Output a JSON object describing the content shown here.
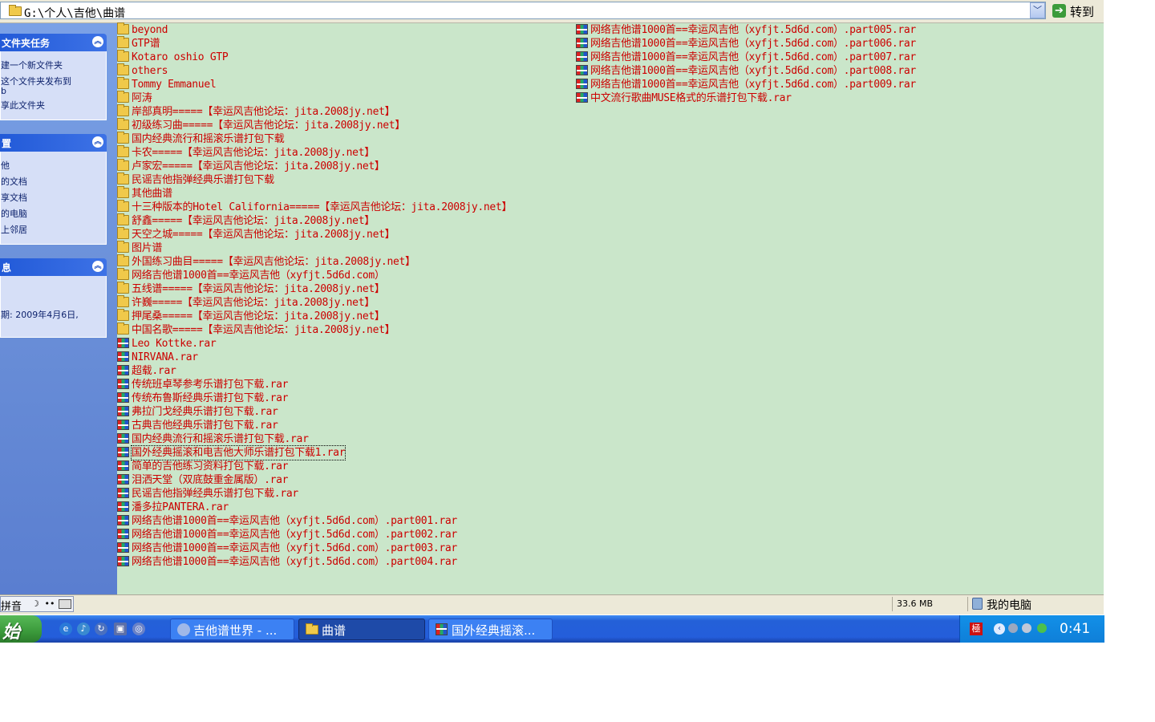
{
  "address": {
    "path": "G:\\个人\\吉他\\曲谱",
    "go_label": "转到",
    "dropdown_glyph": "﹀"
  },
  "tasks_panel": {
    "title": "文件夹任务",
    "items": [
      "建一个新文件夹",
      "这个文件夹发布到",
      "b",
      "享此文件夹"
    ]
  },
  "places_panel": {
    "title": "置",
    "items": [
      "他",
      "的文档",
      "享文档",
      "的电脑",
      "上邻居"
    ]
  },
  "details_panel": {
    "title": "息",
    "items": [
      "期: 2009年4月6日,"
    ]
  },
  "files_col1": [
    {
      "name": "beyond",
      "type": "folder"
    },
    {
      "name": "GTP谱",
      "type": "folder"
    },
    {
      "name": "Kotaro oshio GTP",
      "type": "folder"
    },
    {
      "name": "others",
      "type": "folder"
    },
    {
      "name": "Tommy Emmanuel",
      "type": "folder"
    },
    {
      "name": "阿涛",
      "type": "folder"
    },
    {
      "name": "岸部真明=====【幸运风吉他论坛：jita.2008jy.net】",
      "type": "folder"
    },
    {
      "name": "初级练习曲=====【幸运风吉他论坛：jita.2008jy.net】",
      "type": "folder"
    },
    {
      "name": "国内经典流行和摇滚乐谱打包下载",
      "type": "folder"
    },
    {
      "name": "卡农=====【幸运风吉他论坛：jita.2008jy.net】",
      "type": "folder"
    },
    {
      "name": "卢家宏=====【幸运风吉他论坛：jita.2008jy.net】",
      "type": "folder"
    },
    {
      "name": "民谣吉他指弹经典乐谱打包下载",
      "type": "folder"
    },
    {
      "name": "其他曲谱",
      "type": "folder"
    },
    {
      "name": "十三种版本的Hotel California=====【幸运风吉他论坛：jita.2008jy.net】",
      "type": "folder"
    },
    {
      "name": "舒鑫=====【幸运风吉他论坛：jita.2008jy.net】",
      "type": "folder"
    },
    {
      "name": "天空之城=====【幸运风吉他论坛：jita.2008jy.net】",
      "type": "folder"
    },
    {
      "name": "图片谱",
      "type": "folder"
    },
    {
      "name": "外国练习曲目=====【幸运风吉他论坛：jita.2008jy.net】",
      "type": "folder"
    },
    {
      "name": "网络吉他谱1000首==幸运风吉他（xyfjt.5d6d.com）",
      "type": "folder"
    },
    {
      "name": "五线谱=====【幸运风吉他论坛：jita.2008jy.net】",
      "type": "folder"
    },
    {
      "name": "许巍=====【幸运风吉他论坛：jita.2008jy.net】",
      "type": "folder"
    },
    {
      "name": "押尾桑=====【幸运风吉他论坛：jita.2008jy.net】",
      "type": "folder"
    },
    {
      "name": "中国名歌=====【幸运风吉他论坛：jita.2008jy.net】",
      "type": "folder"
    },
    {
      "name": "Leo Kottke.rar",
      "type": "rar"
    },
    {
      "name": "NIRVANA.rar",
      "type": "rar"
    },
    {
      "name": "超载.rar",
      "type": "rar"
    },
    {
      "name": "传统班卓琴参考乐谱打包下载.rar",
      "type": "rar"
    },
    {
      "name": "传统布鲁斯经典乐谱打包下载.rar",
      "type": "rar"
    },
    {
      "name": "弗拉门戈经典乐谱打包下载.rar",
      "type": "rar"
    },
    {
      "name": "古典吉他经典乐谱打包下载.rar",
      "type": "rar"
    },
    {
      "name": "国内经典流行和摇滚乐谱打包下载.rar",
      "type": "rar"
    },
    {
      "name": "国外经典摇滚和电吉他大师乐谱打包下载1.rar",
      "type": "rar",
      "selected": true
    },
    {
      "name": "简单的吉他练习资料打包下载.rar",
      "type": "rar"
    },
    {
      "name": "泪洒天堂（双底鼓重金属版）.rar",
      "type": "rar"
    },
    {
      "name": "民谣吉他指弹经典乐谱打包下载.rar",
      "type": "rar"
    },
    {
      "name": "潘多拉PANTERA.rar",
      "type": "rar"
    },
    {
      "name": "网络吉他谱1000首==幸运风吉他（xyfjt.5d6d.com）.part001.rar",
      "type": "rar"
    },
    {
      "name": "网络吉他谱1000首==幸运风吉他（xyfjt.5d6d.com）.part002.rar",
      "type": "rar"
    },
    {
      "name": "网络吉他谱1000首==幸运风吉他（xyfjt.5d6d.com）.part003.rar",
      "type": "rar"
    },
    {
      "name": "网络吉他谱1000首==幸运风吉他（xyfjt.5d6d.com）.part004.rar",
      "type": "rar"
    }
  ],
  "files_col2": [
    {
      "name": "网络吉他谱1000首==幸运风吉他（xyfjt.5d6d.com）.part005.rar",
      "type": "rar"
    },
    {
      "name": "网络吉他谱1000首==幸运风吉他（xyfjt.5d6d.com）.part006.rar",
      "type": "rar"
    },
    {
      "name": "网络吉他谱1000首==幸运风吉他（xyfjt.5d6d.com）.part007.rar",
      "type": "rar"
    },
    {
      "name": "网络吉他谱1000首==幸运风吉他（xyfjt.5d6d.com）.part008.rar",
      "type": "rar"
    },
    {
      "name": "网络吉他谱1000首==幸运风吉他（xyfjt.5d6d.com）.part009.rar",
      "type": "rar"
    },
    {
      "name": "中文流行歌曲MUSE格式的乐谱打包下载.rar",
      "type": "rar"
    }
  ],
  "statusbar": {
    "ime_label": "拼音",
    "ime_moon": "☽",
    "ime_dots": "••",
    "size": "33.6 MB",
    "location": "我的电脑"
  },
  "taskbar": {
    "start_label": "始",
    "quicklaunch": [
      "ie-icon",
      "media-icon",
      "refresh-icon",
      "app-icon",
      "browser-icon"
    ],
    "tasks": [
      {
        "label": "吉他谱世界 - ...",
        "icon": "browser-icon"
      },
      {
        "label": "曲谱",
        "icon": "folder-icon"
      },
      {
        "label": "国外经典摇滚...",
        "icon": "rar-icon"
      }
    ],
    "tray_ime": "極",
    "tray_arrow": "‹",
    "clock": "0:41"
  },
  "colors": {
    "file_text": "#cc0000",
    "file_bg": "#cae6ca",
    "taskbar": "#245edb"
  }
}
